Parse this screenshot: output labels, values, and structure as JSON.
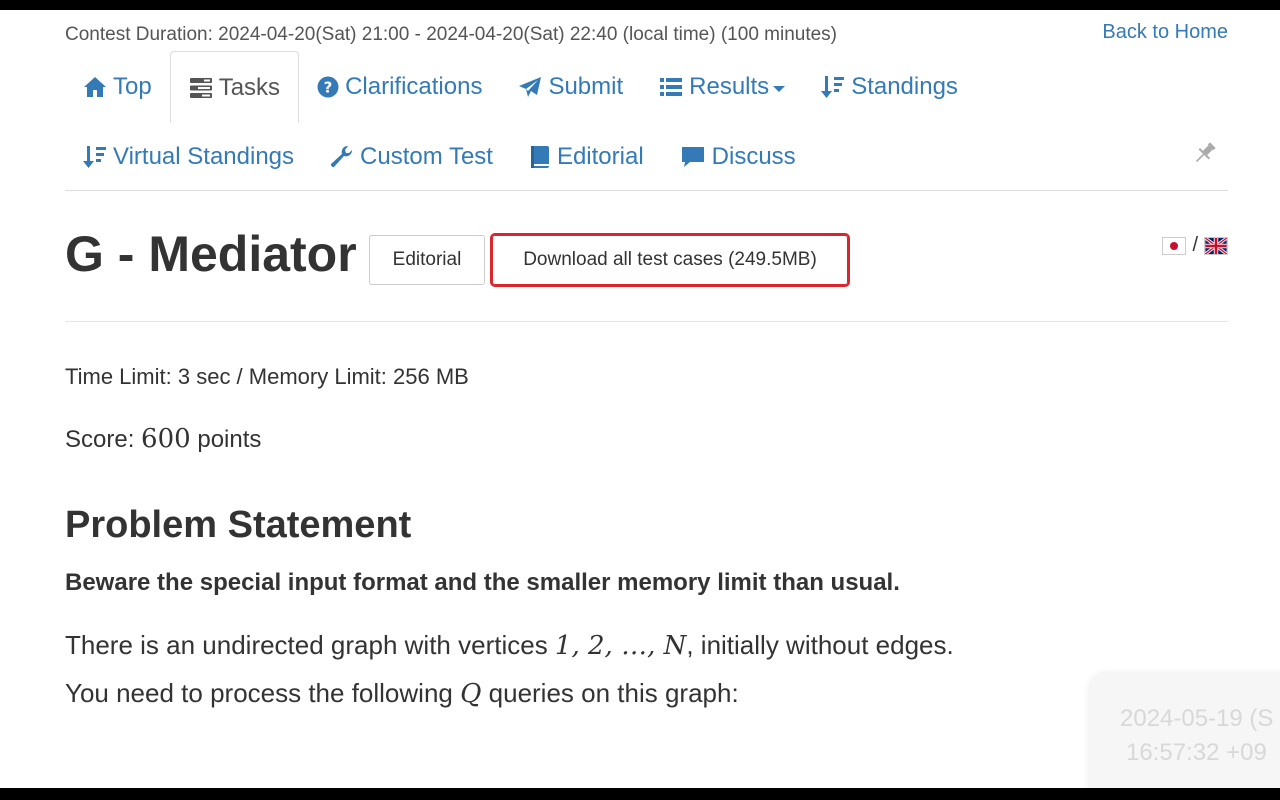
{
  "header": {
    "contest_duration": "Contest Duration: 2024-04-20(Sat) 21:00 - 2024-04-20(Sat) 22:40 (local time) (100 minutes)",
    "back_to_home": "Back to Home"
  },
  "nav": {
    "row1": [
      {
        "label": "Top",
        "icon": "home-icon"
      },
      {
        "label": "Tasks",
        "icon": "tasks-icon"
      },
      {
        "label": "Clarifications",
        "icon": "question-circle-icon"
      },
      {
        "label": "Submit",
        "icon": "paper-plane-icon"
      },
      {
        "label": "Results",
        "icon": "list-icon"
      },
      {
        "label": "Standings",
        "icon": "sort-amount-icon"
      }
    ],
    "row2": [
      {
        "label": "Virtual Standings",
        "icon": "sort-amount-icon"
      },
      {
        "label": "Custom Test",
        "icon": "wrench-icon"
      },
      {
        "label": "Editorial",
        "icon": "book-icon"
      },
      {
        "label": "Discuss",
        "icon": "comment-icon"
      }
    ],
    "active": "Tasks",
    "link_color": "#337ab7"
  },
  "task": {
    "title": "G - Mediator",
    "editorial_button": "Editorial",
    "download_button": "Download all test cases (249.5MB)",
    "highlight_color": "#d9252b",
    "lang_separator": "/",
    "limits": "Time Limit: 3 sec / Memory Limit: 256 MB",
    "score_prefix": "Score: ",
    "score_value": "600",
    "score_suffix": " points"
  },
  "statement": {
    "heading": "Problem Statement",
    "warning": "Beware the special input format and the smaller memory limit than usual.",
    "line1_before": "There is an undirected graph with vertices ",
    "line1_math": "1, 2, …, N",
    "line1_after": ", initially without edges.",
    "line2_before": "You need to process the following ",
    "line2_math": "Q",
    "line2_after": " queries on this graph:"
  },
  "clock": {
    "date": "2024-05-19 (S",
    "time": "16:57:32 +09"
  }
}
